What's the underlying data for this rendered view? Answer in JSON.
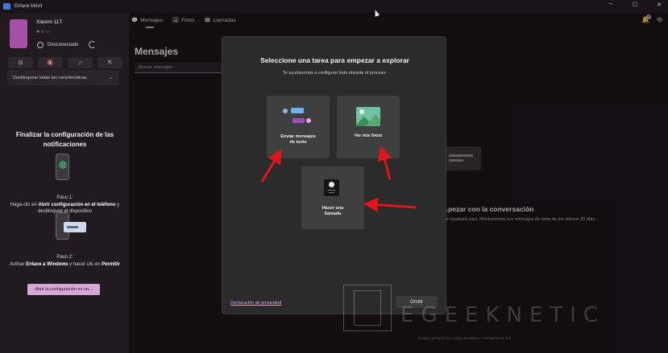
{
  "window": {
    "title": "Enlace Móvil"
  },
  "sidebar": {
    "device_name": "Xiaomi 11T",
    "connection_status": "Desconectado",
    "quick_actions": [
      "⊟",
      "🔇",
      "♫",
      "⇱"
    ],
    "features_dropdown": "Desbloquear todas las características",
    "setup": {
      "title": "Finalizar la configuración de las notificaciones",
      "step1_label": "Paso 1:",
      "step1_pre": "Haga clic en ",
      "step1_bold1": "Abrir configuración en el teléfono",
      "step1_post": " y desbloquee el dispositivo",
      "step2_label": "Paso 2:",
      "step2_pre": "Activar ",
      "step2_bold1": "Enlace a Windows",
      "step2_mid": " y hacer clic en ",
      "step2_bold2": "Permitir",
      "open_button": "Abrir la configuración en un..."
    }
  },
  "header": {
    "tabs": [
      {
        "icon": "💬",
        "label": "Mensajes"
      },
      {
        "icon": "🖼",
        "label": "Fotos"
      },
      {
        "icon": "☎",
        "label": "Llamadas"
      }
    ],
    "notification_badge": "0"
  },
  "main": {
    "title": "Mensajes",
    "search_placeholder": "Buscar mensajes",
    "conversation_title": "...pezar con la conversación",
    "conversation_sub": "...e mostrará aquí. Mostraremos sus mensajes de texto de los últimos 30 días.",
    "footer_note": "Pueden aplicarse los cargos de datos y mensajería de red."
  },
  "modal": {
    "title": "Seleccione una tarea para empezar a explorar",
    "subtitle": "Te ayudaremos a configurar todo durante el proceso.",
    "cards": {
      "messages": "Enviar mensajes de texto",
      "photos": "Ver mis fotos",
      "calls": "Hacer una llamada"
    },
    "privacy_link": "Declaración de privacidad",
    "skip_button": "Omitir"
  },
  "watermark": {
    "text": "GEEKNETIC",
    "logo": "E"
  },
  "colors": {
    "accent": "#d8a6d6",
    "arrow": "#e0151b",
    "modal_bg": "#2c2b2c"
  }
}
